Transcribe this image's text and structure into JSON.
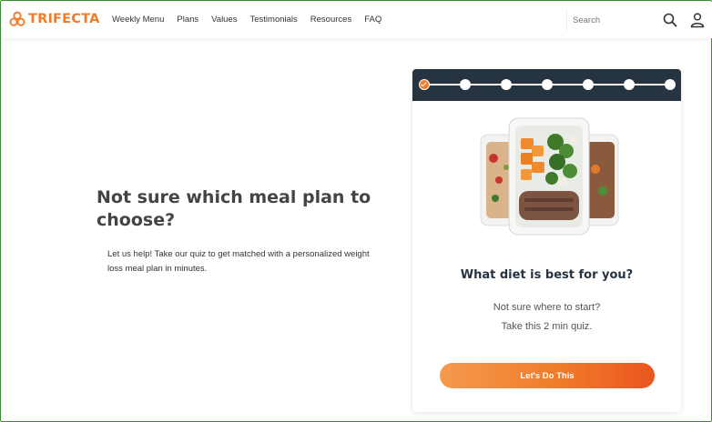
{
  "brand": {
    "name": "TRIFECTA",
    "accent": "#f07c2a",
    "dark": "#263442"
  },
  "nav": {
    "items": [
      "Weekly Menu",
      "Plans",
      "Values",
      "Testimonials",
      "Resources",
      "FAQ"
    ],
    "search_placeholder": "Search",
    "icons": {
      "search": "search-icon",
      "user": "user-icon"
    }
  },
  "hero": {
    "title": "Not sure which meal plan to choose?",
    "subtitle": "Let us help! Take our quiz to get matched with a personalized weight loss meal plan in minutes."
  },
  "quiz": {
    "total_steps": 7,
    "completed_steps": 1,
    "title": "What diet is best for you?",
    "line1": "Not sure where to start?",
    "line2": "Take this 2 min quiz.",
    "button_label": "Let's Do This"
  }
}
